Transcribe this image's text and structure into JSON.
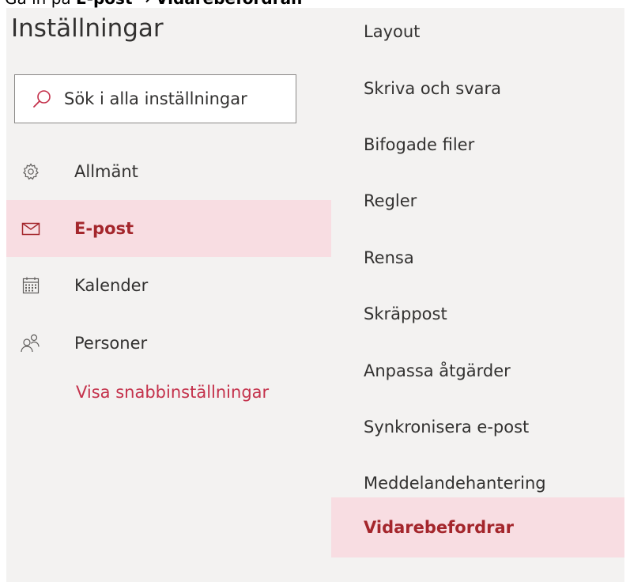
{
  "caption": {
    "prefix": "Gå in på",
    "email": "E-post",
    "arrow": "→",
    "target": "Vidarebefordran"
  },
  "settings": {
    "title": "Inställningar",
    "search_placeholder": "Sök i alla inställningar"
  },
  "nav": {
    "items": [
      {
        "label": "Allmänt",
        "icon": "gear-icon",
        "active": false
      },
      {
        "label": "E-post",
        "icon": "mail-icon",
        "active": true
      },
      {
        "label": "Kalender",
        "icon": "calendar-icon",
        "active": false
      },
      {
        "label": "Personer",
        "icon": "people-icon",
        "active": false
      }
    ],
    "quick_settings_link": "Visa snabbinställningar"
  },
  "submenu": {
    "items": [
      {
        "label": "Layout",
        "active": false
      },
      {
        "label": "Skriva och svara",
        "active": false
      },
      {
        "label": "Bifogade filer",
        "active": false
      },
      {
        "label": "Regler",
        "active": false
      },
      {
        "label": "Rensa",
        "active": false
      },
      {
        "label": "Skräppost",
        "active": false
      },
      {
        "label": "Anpassa åtgärder",
        "active": false
      },
      {
        "label": "Synkronisera e-post",
        "active": false
      },
      {
        "label": "Meddelandehantering",
        "active": false
      },
      {
        "label": "Vidarebefordrar",
        "active": true
      }
    ]
  },
  "colors": {
    "accent": "#a4262c",
    "link": "#c4314b",
    "selected_bg": "#f8dde2",
    "panel_bg": "#f3f2f1"
  }
}
